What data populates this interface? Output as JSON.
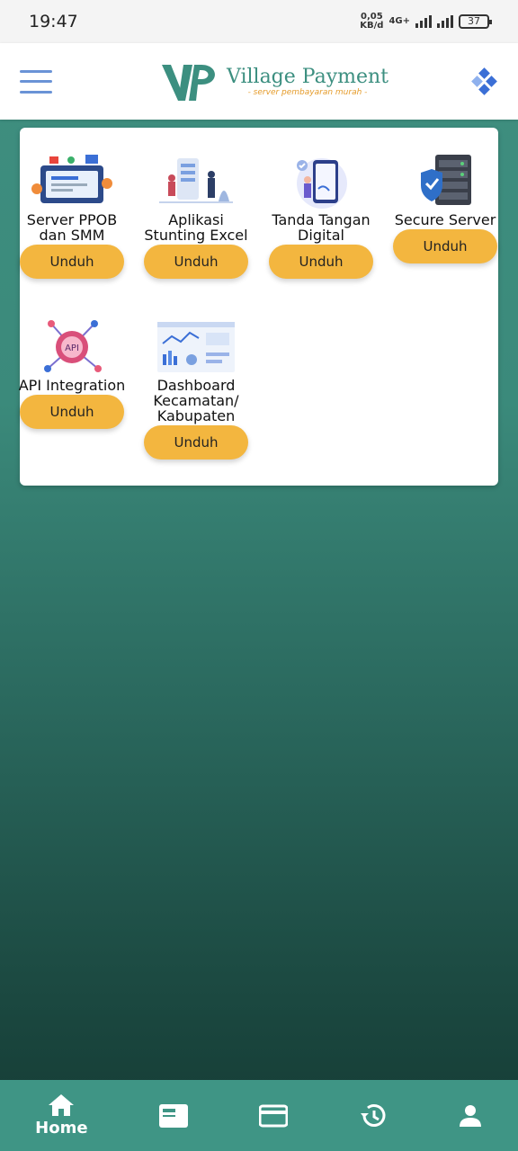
{
  "status_bar": {
    "time": "19:47",
    "data_rate_top": "0,05",
    "data_rate_bottom": "KB/d",
    "network": "4G+",
    "battery": "37"
  },
  "header": {
    "logo_mark": "VP",
    "title": "Village Payment",
    "subtitle": "- server pembayaran murah -"
  },
  "products": [
    {
      "label": "Server PPOB dan SMM",
      "button": "Unduh",
      "icon": "server-ppob-illustration"
    },
    {
      "label": "Aplikasi Stunting Excel",
      "button": "Unduh",
      "icon": "stunting-app-illustration"
    },
    {
      "label": "Tanda Tangan Digital",
      "button": "Unduh",
      "icon": "digital-signature-illustration"
    },
    {
      "label": "Secure Server",
      "button": "Unduh",
      "icon": "secure-server-illustration"
    },
    {
      "label": "API Integration",
      "button": "Unduh",
      "icon": "api-gear-illustration"
    },
    {
      "label": "Dashboard Kecamatan/ Kabupaten",
      "button": "Unduh",
      "icon": "dashboard-illustration"
    }
  ],
  "bottom_nav": {
    "home_label": "Home",
    "items": [
      "home-icon",
      "card-icon",
      "wallet-icon",
      "history-icon",
      "profile-icon"
    ]
  },
  "colors": {
    "accent": "#3f9585",
    "button": "#f3b63f",
    "logo_blue": "#6a93d6"
  }
}
